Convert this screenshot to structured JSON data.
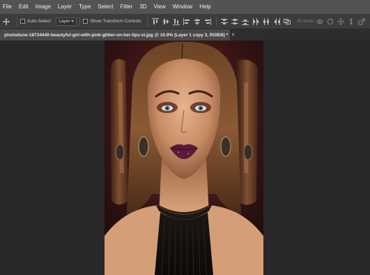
{
  "menu": [
    "File",
    "Edit",
    "Image",
    "Layer",
    "Type",
    "Select",
    "Filter",
    "3D",
    "View",
    "Window",
    "Help"
  ],
  "options": {
    "tool_icon": "move-tool-icon",
    "auto_select_label": "Auto-Select:",
    "auto_select_target": "Layer",
    "show_transform_label": "Show Transform Controls",
    "mode_3d_label": "3D Mode:"
  },
  "document": {
    "tab_title": "photodune-18734440-beautyful-girl-with-pink-glitter-on-her-lips-xl.jpg @ 10.9% (Layer 1 copy 3, RGB/8) *"
  },
  "colors": {
    "menubar": "#535353",
    "optionsbar": "#3c3c3c",
    "workspace": "#282828",
    "active_tab": "#4a4a4a"
  }
}
